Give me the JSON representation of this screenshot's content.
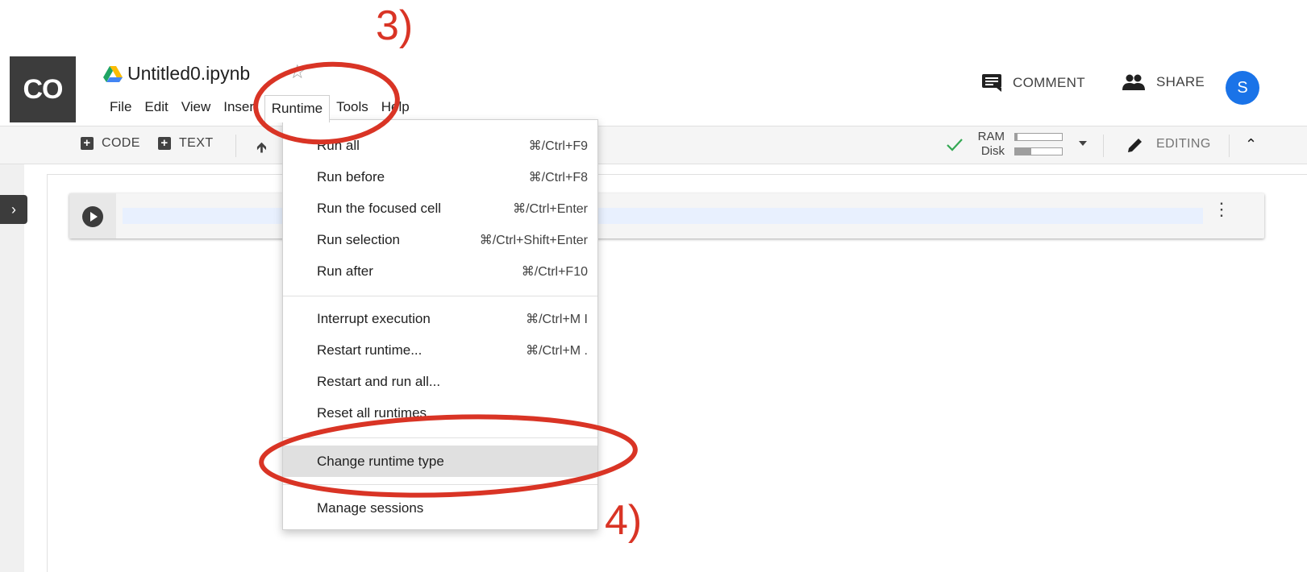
{
  "header": {
    "logo_text": "CO",
    "notebook_title": "Untitled0.ipynb",
    "menu": [
      "File",
      "Edit",
      "View",
      "Insert",
      "Runtime",
      "Tools",
      "Help"
    ],
    "active_menu": "Runtime",
    "comment_label": "COMMENT",
    "share_label": "SHARE",
    "avatar_letter": "S"
  },
  "toolbar": {
    "code_label": "CODE",
    "text_label": "TEXT",
    "ram_label": "RAM",
    "disk_label": "Disk",
    "ram_usage": 0.05,
    "disk_usage": 0.35,
    "editing_label": "EDITING"
  },
  "runtime_menu": {
    "items": [
      {
        "label": "Run all",
        "shortcut": "⌘/Ctrl+F9"
      },
      {
        "label": "Run before",
        "shortcut": "⌘/Ctrl+F8"
      },
      {
        "label": "Run the focused cell",
        "shortcut": "⌘/Ctrl+Enter"
      },
      {
        "label": "Run selection",
        "shortcut": "⌘/Ctrl+Shift+Enter"
      },
      {
        "label": "Run after",
        "shortcut": "⌘/Ctrl+F10"
      },
      {
        "label": "Interrupt execution",
        "shortcut": "⌘/Ctrl+M I"
      },
      {
        "label": "Restart runtime...",
        "shortcut": "⌘/Ctrl+M ."
      },
      {
        "label": "Restart and run all...",
        "shortcut": ""
      },
      {
        "label": "Reset all runtimes...",
        "shortcut": ""
      },
      {
        "label": "Change runtime type",
        "shortcut": ""
      },
      {
        "label": "Manage sessions",
        "shortcut": ""
      }
    ],
    "highlighted": "Change runtime type"
  },
  "annotations": {
    "step3": "3)",
    "step4": "4)",
    "color": "#d93425"
  },
  "icons": {
    "drive": "google-drive-icon",
    "star": "star-outline-icon",
    "comment": "comment-icon",
    "share": "people-icon",
    "check": "check-icon",
    "pencil": "pencil-icon"
  }
}
